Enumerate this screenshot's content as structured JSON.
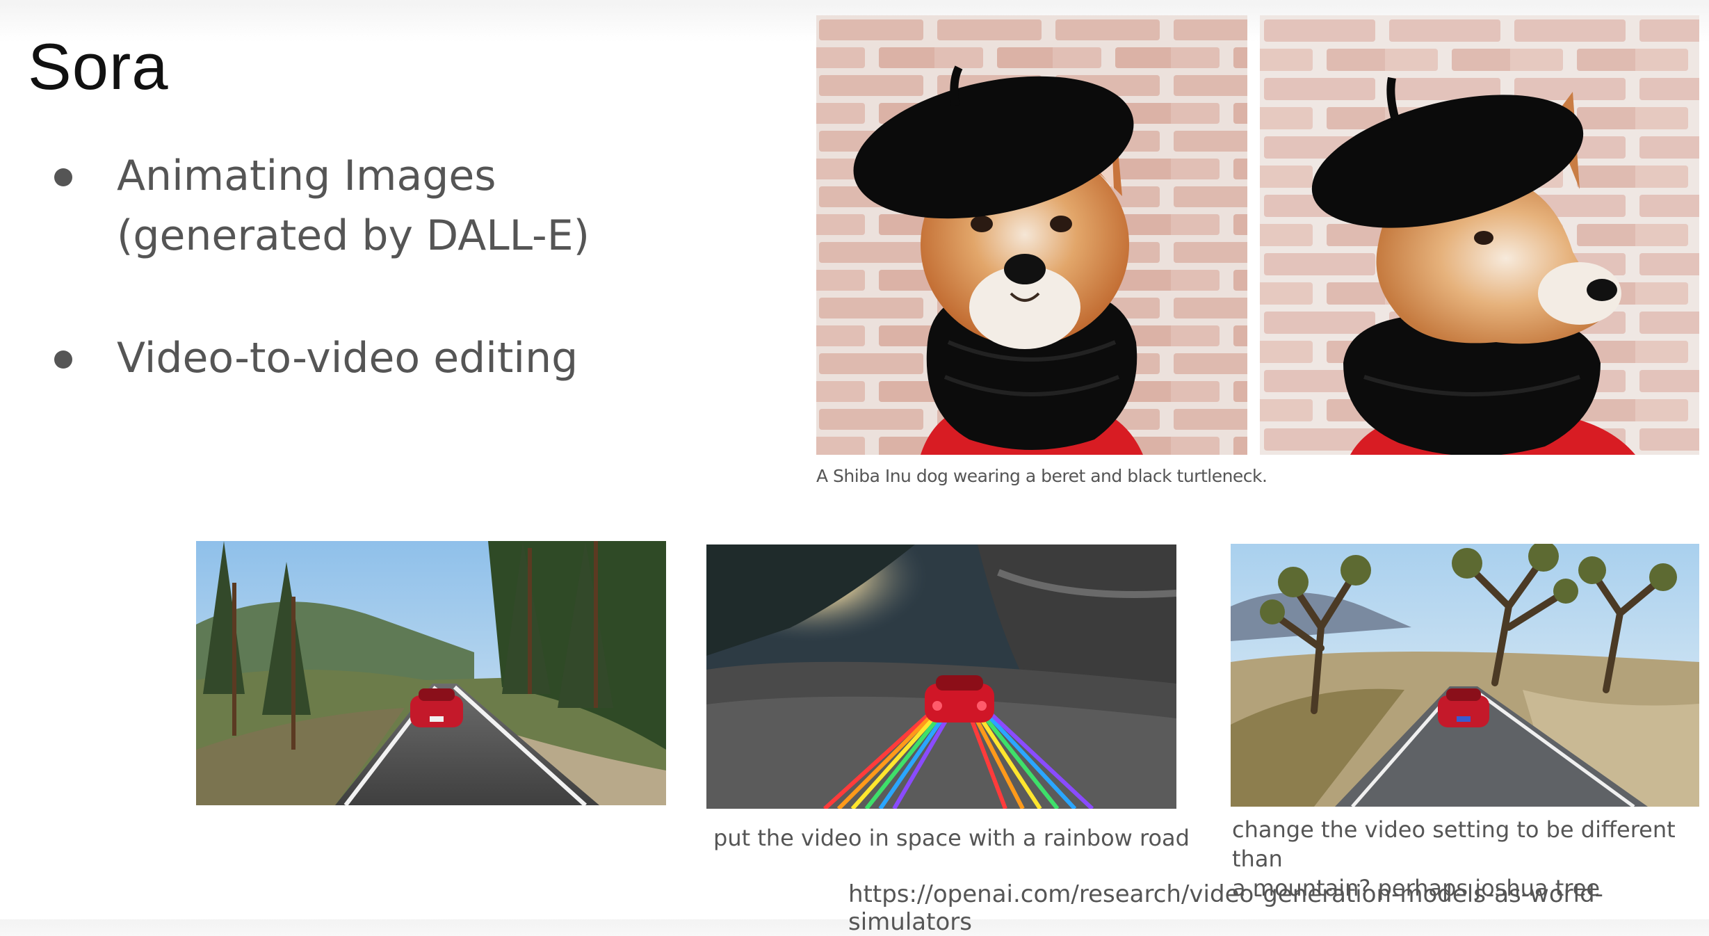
{
  "slide": {
    "title": "Sora",
    "bullets": [
      {
        "text": "Animating Images\n(generated by DALL-E)"
      },
      {
        "text": "Video-to-video editing"
      }
    ]
  },
  "images": {
    "dog_caption": "A Shiba Inu dog wearing a beret and black turtleneck.",
    "caption_rainbow": "put the video in space with a rainbow road",
    "caption_joshua": "change the video setting to be different than\na mountain? perhaps joshua tree",
    "source_url": "https://openai.com/research/video-generation-models-as-world-simulators"
  }
}
